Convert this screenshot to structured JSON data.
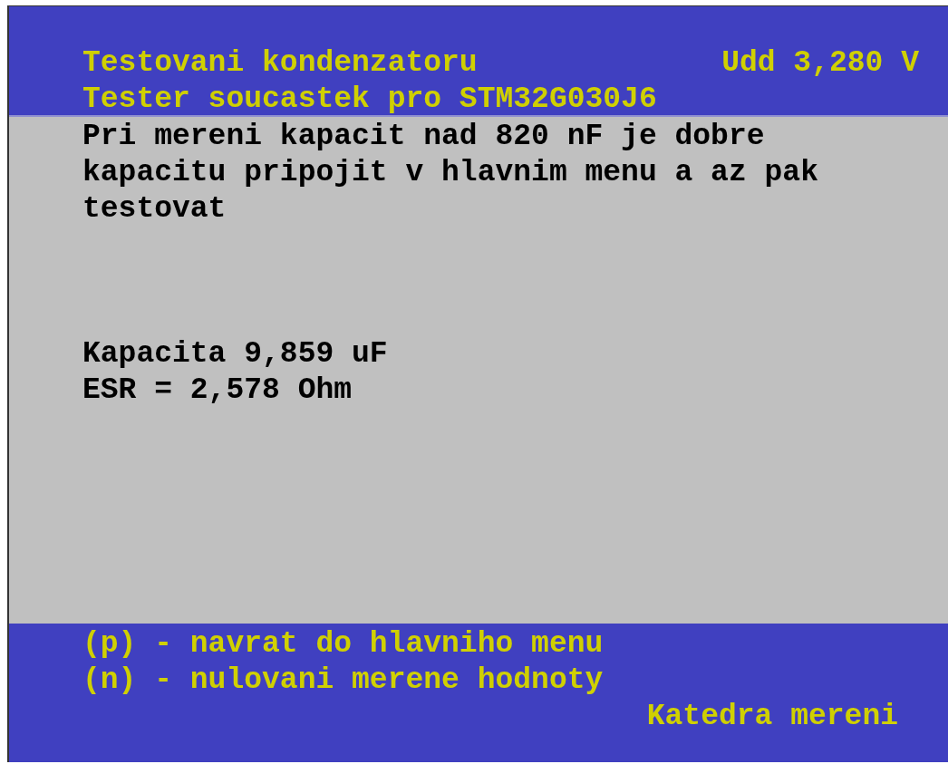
{
  "header": {
    "title": "Testovani kondenzatoru",
    "voltage": "Udd 3,280 V",
    "subtitle": "Tester soucastek pro STM32G030J6"
  },
  "body": {
    "note_lines": [
      "Pri mereni kapacit nad 820 nF je dobre",
      "kapacitu pripojit v hlavnim menu a az pak",
      "testovat"
    ],
    "results": [
      "Kapacita 9,859 uF",
      "ESR = 2,578 Ohm"
    ]
  },
  "footer": {
    "keys": [
      "(p) - navrat do hlavniho menu",
      "(n) - nulovani merene hodnoty"
    ],
    "credit": "Katedra mereni"
  }
}
